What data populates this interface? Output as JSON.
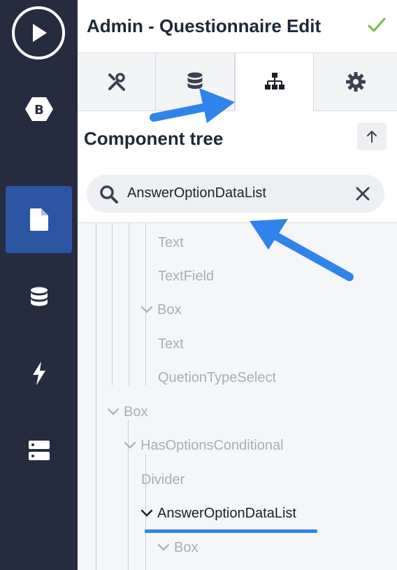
{
  "sidebar": {
    "items": [
      {
        "name": "play-icon"
      },
      {
        "name": "bootstrap-icon",
        "label": "B"
      },
      {
        "name": "page-icon",
        "active": true
      },
      {
        "name": "database-icon"
      },
      {
        "name": "lightning-icon"
      },
      {
        "name": "server-icon"
      }
    ]
  },
  "header": {
    "title": "Admin - Questionnaire Edit",
    "status_icon": "check-icon",
    "status_color": "#6cc24a"
  },
  "tabs": [
    {
      "name": "tools-icon",
      "active": false
    },
    {
      "name": "database-icon",
      "active": false
    },
    {
      "name": "sitemap-icon",
      "active": true
    },
    {
      "name": "gear-icon",
      "active": false
    }
  ],
  "component_tree": {
    "title": "Component tree",
    "up_button_icon": "arrow-up-icon",
    "search": {
      "value": "AnswerOptionDataList",
      "icon": "search-icon",
      "clear_icon": "close-icon"
    },
    "nodes": [
      {
        "label": "Text",
        "expandable": false
      },
      {
        "label": "TextField",
        "expandable": false
      },
      {
        "label": "Box",
        "expandable": true
      },
      {
        "label": "Text",
        "expandable": false
      },
      {
        "label": "QuetionTypeSelect",
        "expandable": false
      },
      {
        "label": "Box",
        "expandable": true
      },
      {
        "label": "HasOptionsConditional",
        "expandable": true
      },
      {
        "label": "Divider",
        "expandable": false
      },
      {
        "label": "AnswerOptionDataList",
        "expandable": true,
        "matched": true
      },
      {
        "label": "Box",
        "expandable": true
      }
    ]
  },
  "colors": {
    "rail": "#262c3f",
    "rail_active": "#2c55a4",
    "annotation": "#2f84ec"
  }
}
